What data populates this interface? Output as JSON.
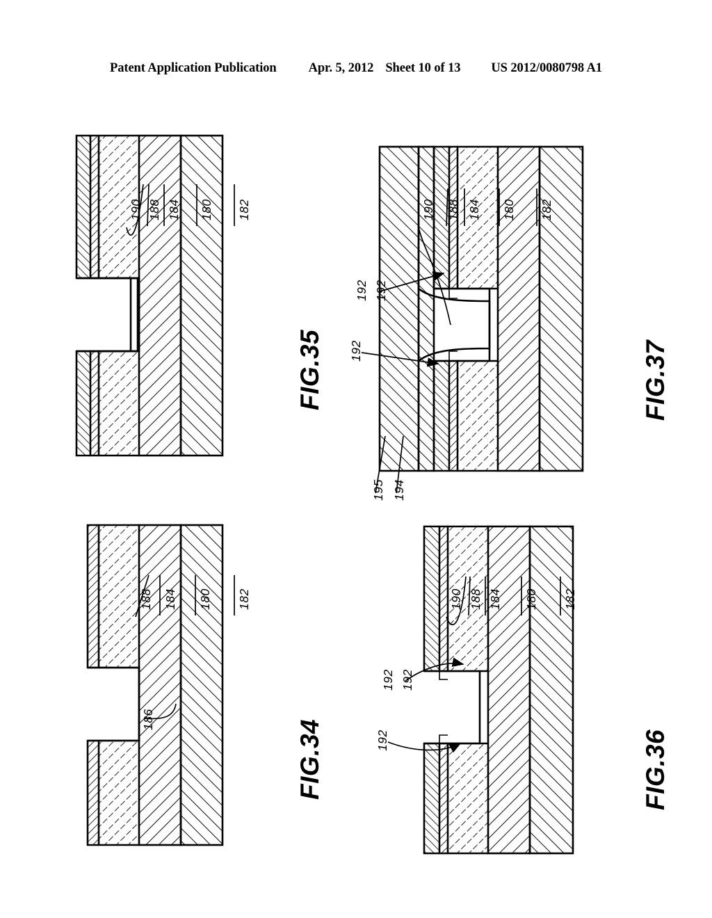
{
  "header": {
    "publication": "Patent Application Publication",
    "date": "Apr. 5, 2012",
    "sheet": "Sheet 10 of 13",
    "publication_number": "US 2012/0080798 A1"
  },
  "figures": [
    {
      "id": "fig34",
      "caption": "FIG.34",
      "layer_labels": [
        "188",
        "184",
        "180",
        "182"
      ],
      "callouts": [
        "186"
      ]
    },
    {
      "id": "fig35",
      "caption": "FIG.35",
      "layer_labels": [
        "190",
        "188",
        "184",
        "180",
        "182"
      ],
      "callouts": []
    },
    {
      "id": "fig36",
      "caption": "FIG.36",
      "layer_labels": [
        "190",
        "188",
        "184",
        "180",
        "182"
      ],
      "callouts": [
        "192",
        "192",
        "192"
      ]
    },
    {
      "id": "fig37",
      "caption": "FIG.37",
      "layer_labels": [
        "190",
        "188",
        "184",
        "180",
        "182"
      ],
      "callouts": [
        "192",
        "192",
        "192"
      ],
      "bottom_labels": [
        "195",
        "194"
      ]
    }
  ],
  "fig34": {
    "caption": "FIG.34",
    "ref_188": "188",
    "ref_184": "184",
    "ref_180": "180",
    "ref_182": "182",
    "ref_186": "186"
  },
  "fig35": {
    "caption": "FIG.35",
    "ref_190": "190",
    "ref_188": "188",
    "ref_184": "184",
    "ref_180": "180",
    "ref_182": "182"
  },
  "fig36": {
    "caption": "FIG.36",
    "ref_190": "190",
    "ref_188": "188",
    "ref_184": "184",
    "ref_180": "180",
    "ref_182": "182",
    "ref_192_a": "192",
    "ref_192_b": "192",
    "ref_192_c": "192"
  },
  "fig37": {
    "caption": "FIG.37",
    "ref_190": "190",
    "ref_188": "188",
    "ref_184": "184",
    "ref_180": "180",
    "ref_182": "182",
    "ref_192_a": "192",
    "ref_192_b": "192",
    "ref_192_c": "192",
    "ref_195": "195",
    "ref_194": "194"
  },
  "colors": {
    "ink": "#000000",
    "paper": "#ffffff"
  }
}
